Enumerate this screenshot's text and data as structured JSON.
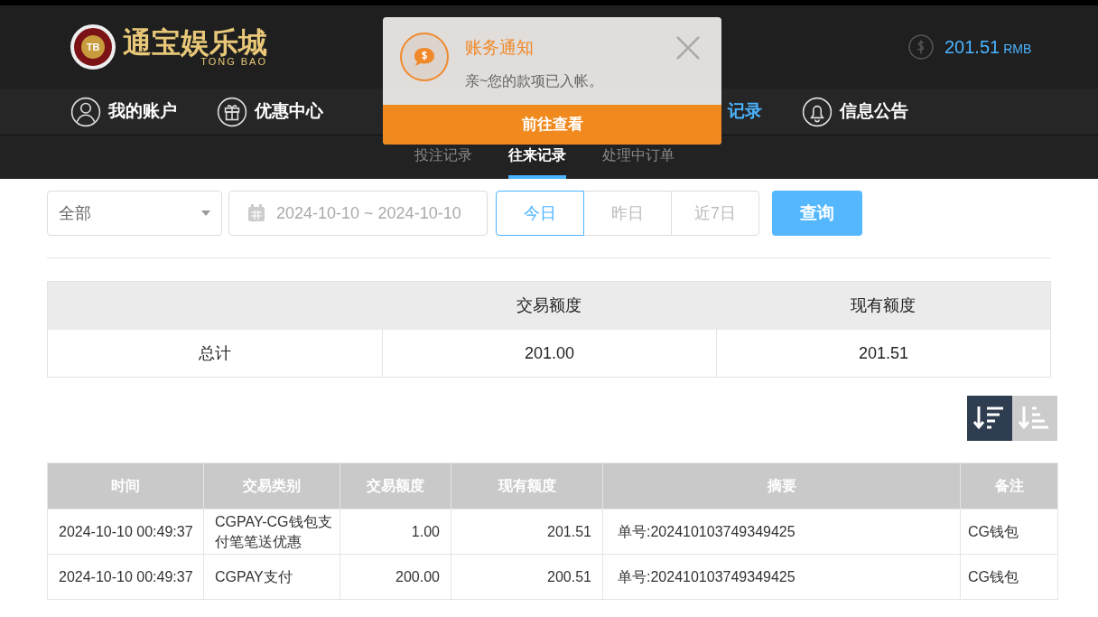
{
  "header": {
    "logo": {
      "title": "通宝娱乐城",
      "subtitle": "TONG BAO",
      "badge": "TB"
    },
    "balance": {
      "amount": "201.51",
      "currency": "RMB"
    }
  },
  "nav": [
    {
      "label": "我的账户",
      "kind": "account",
      "selected": false
    },
    {
      "label": "优惠中心",
      "kind": "gift",
      "selected": false
    },
    {
      "label": "记录",
      "kind": "partial",
      "selected": true
    },
    {
      "label": "信息公告",
      "kind": "bell",
      "selected": false
    }
  ],
  "subtabs": [
    {
      "label": "投注记录",
      "selected": false
    },
    {
      "label": "往来记录",
      "selected": true
    },
    {
      "label": "处理中订单",
      "selected": false
    }
  ],
  "notification": {
    "title": "账务通知",
    "message": "亲~您的款项已入帐。",
    "action": "前往查看"
  },
  "filters": {
    "type": "全部",
    "date_range": "2024-10-10 ~ 2024-10-10",
    "presets": [
      {
        "label": "今日",
        "selected": true
      },
      {
        "label": "昨日",
        "selected": false
      },
      {
        "label": "近7日",
        "selected": false
      }
    ],
    "search": "查询"
  },
  "summary": {
    "columns": [
      "交易额度",
      "现有额度"
    ],
    "row": [
      "总计",
      "201.00",
      "201.51"
    ]
  },
  "sort": [
    {
      "kind": "desc",
      "selected": true
    },
    {
      "kind": "asc",
      "selected": false
    }
  ],
  "table": {
    "columns": [
      "时间",
      "交易类别",
      "交易额度",
      "现有额度",
      "摘要",
      "备注"
    ],
    "rows": [
      [
        "2024-10-10 00:49:37",
        "CGPAY-CG钱包支付笔笔送优惠",
        "1.00",
        "201.51",
        "单号:202410103749349425",
        "CG钱包"
      ],
      [
        "2024-10-10 00:49:37",
        "CGPAY支付",
        "200.00",
        "200.51",
        "单号:202410103749349425",
        "CG钱包"
      ]
    ]
  }
}
